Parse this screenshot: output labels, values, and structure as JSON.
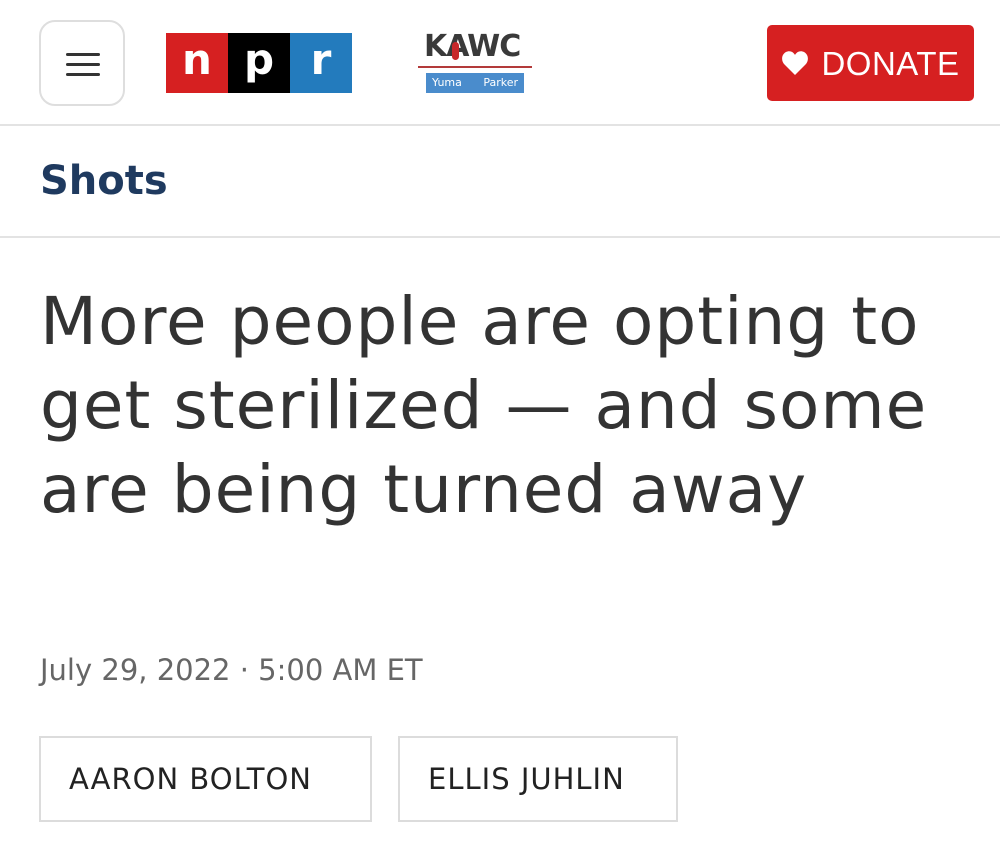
{
  "header": {
    "menu_icon": "hamburger-menu-icon",
    "npr_logo": {
      "letters": [
        "n",
        "p",
        "r"
      ],
      "colors": [
        "#d62021",
        "#000000",
        "#237bbd"
      ]
    },
    "station_logo": {
      "wordmark": "KAWC",
      "left_city": "Yuma",
      "right_city": "Parker"
    },
    "donate": {
      "label": "DONATE",
      "icon": "heart-icon",
      "color": "#d62021"
    }
  },
  "section": {
    "label": "Shots",
    "color": "#1f3a5f"
  },
  "article": {
    "headline": "More people are opting to get sterilized — and some are being turned away",
    "dateline": "July 29, 2022 · 5:00 AM ET",
    "authors": [
      "AARON BOLTON",
      "ELLIS JUHLIN"
    ]
  }
}
